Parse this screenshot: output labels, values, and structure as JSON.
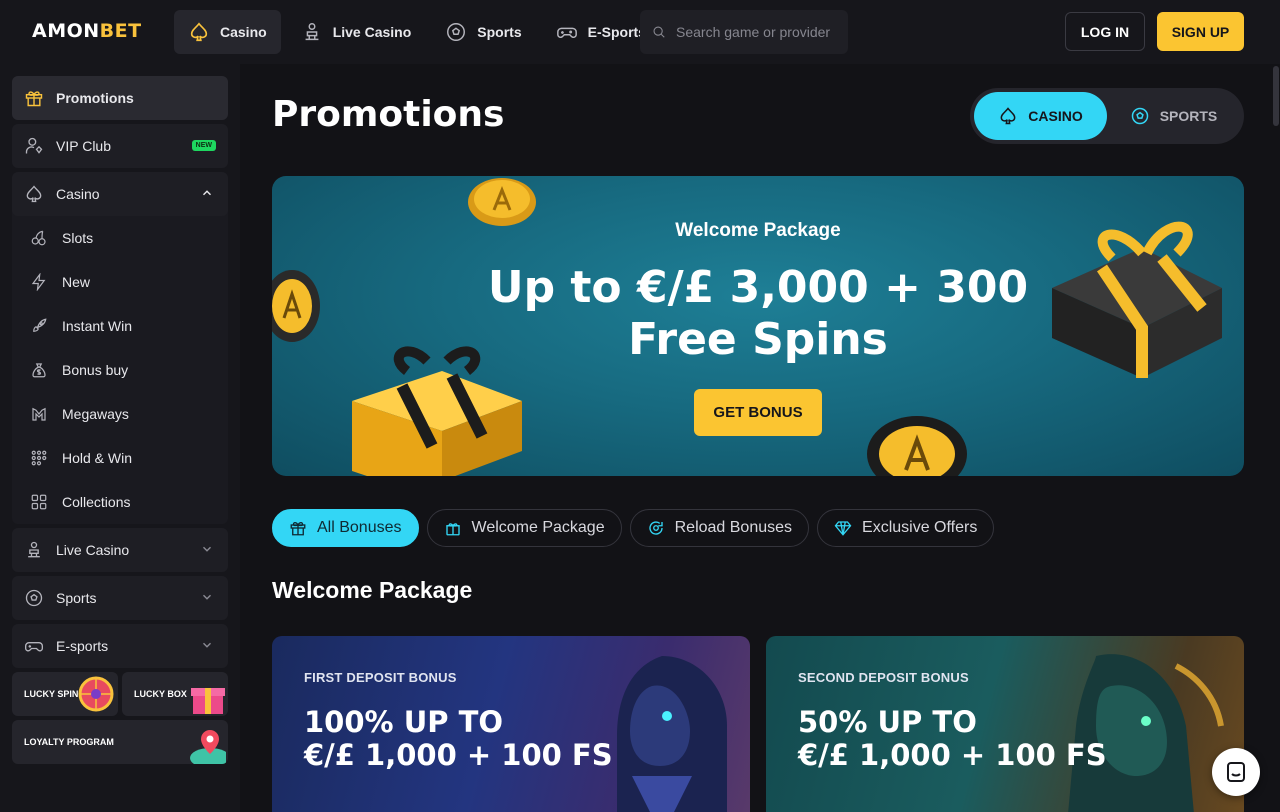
{
  "brand": {
    "logo_part1": "AMON",
    "logo_part2": "BET",
    "accent": "#f9c23c"
  },
  "nav": {
    "items": [
      {
        "label": "Casino",
        "icon": "spade-icon"
      },
      {
        "label": "Live Casino",
        "icon": "dealer-icon"
      },
      {
        "label": "Sports",
        "icon": "soccer-ball-icon"
      },
      {
        "label": "E-Sports",
        "icon": "gamepad-icon"
      }
    ],
    "search_placeholder": "Search game or provider"
  },
  "auth": {
    "login": "LOG IN",
    "signup": "SIGN UP"
  },
  "sidebar": {
    "promotions": "Promotions",
    "vip": "VIP Club",
    "vip_badge": "NEW",
    "casino": "Casino",
    "casino_items": [
      "Slots",
      "New",
      "Instant Win",
      "Bonus buy",
      "Megaways",
      "Hold & Win",
      "Collections"
    ],
    "live_casino": "Live Casino",
    "sports": "Sports",
    "esports": "E-sports",
    "lucky_spin": "LUCKY SPIN",
    "lucky_box": "LUCKY BOX",
    "loyalty": "LOYALTY PROGRAM"
  },
  "page": {
    "title": "Promotions",
    "toggle": {
      "casino": "CASINO",
      "sports": "SPORTS"
    }
  },
  "banner": {
    "subtitle": "Welcome Package",
    "title_line1": "Up to €/£ 3,000 + 300",
    "title_line2": "Free Spins",
    "button": "GET BONUS"
  },
  "filters": [
    "All Bonuses",
    "Welcome Package",
    "Reload Bonuses",
    "Exclusive Offers"
  ],
  "section": {
    "title": "Welcome Package"
  },
  "cards": [
    {
      "label": "FIRST DEPOSIT BONUS",
      "line1": "100% UP TO",
      "line2": "€/£ 1,000 + 100 FS"
    },
    {
      "label": "SECOND DEPOSIT BONUS",
      "line1": "50% UP TO",
      "line2": "€/£ 1,000 + 100 FS"
    }
  ],
  "colors": {
    "cyan": "#33d6f5",
    "yellow": "#fbc531",
    "bg": "#121216",
    "green_badge": "#1ed760"
  }
}
